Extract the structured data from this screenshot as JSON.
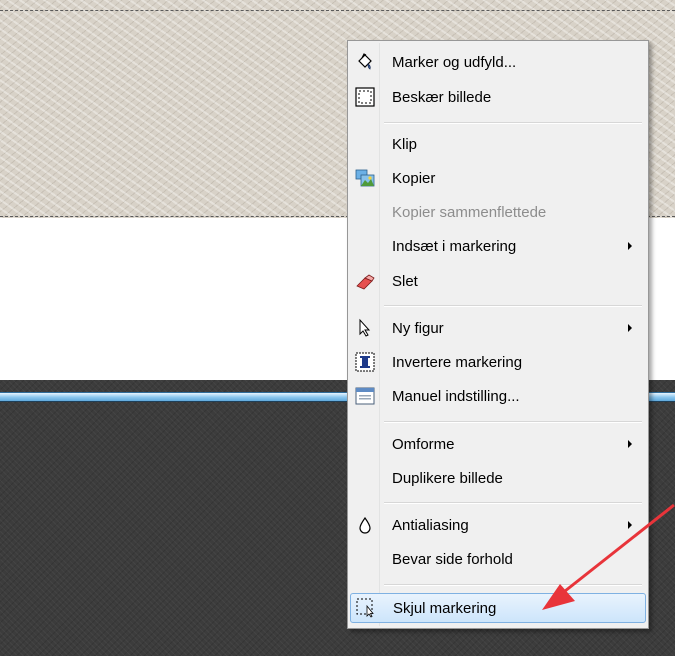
{
  "context_menu": {
    "items": [
      {
        "label": "Marker og udfyld...",
        "icon": "paint-bucket-icon"
      },
      {
        "label": "Beskær billede",
        "icon": "crop-selection-icon"
      },
      {
        "label": "Klip"
      },
      {
        "label": "Kopier",
        "icon": "copy-image-icon"
      },
      {
        "label": "Kopier sammenflettede",
        "disabled": true
      },
      {
        "label": "Indsæt i markering",
        "submenu": true
      },
      {
        "label": "Slet",
        "icon": "eraser-icon"
      },
      {
        "label": "Ny figur",
        "icon": "cursor-icon",
        "submenu": true
      },
      {
        "label": "Invertere markering",
        "icon": "invert-selection-icon"
      },
      {
        "label": "Manuel indstilling...",
        "icon": "dialog-window-icon"
      },
      {
        "label": "Omforme",
        "submenu": true
      },
      {
        "label": "Duplikere billede"
      },
      {
        "label": "Antialiasing",
        "icon": "droplet-icon",
        "submenu": true
      },
      {
        "label": "Bevar side forhold"
      },
      {
        "label": "Skjul markering",
        "icon": "hide-selection-icon",
        "highlighted": true
      }
    ]
  },
  "colors": {
    "annotation_arrow": "#e8343a",
    "menu_highlight": "#cde5fb",
    "canvas_dark": "#3c3c3c",
    "canvas_light": "#d8d2c8"
  }
}
